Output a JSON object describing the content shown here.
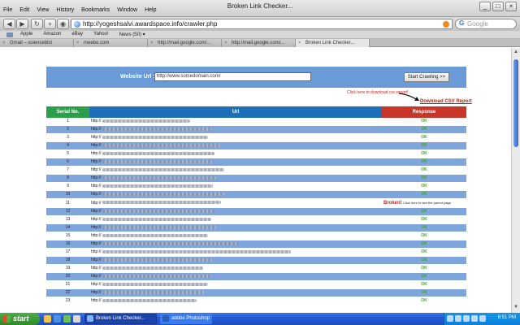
{
  "window": {
    "title": "Broken Link Checker..."
  },
  "menu": [
    "File",
    "Edit",
    "View",
    "History",
    "Bookmarks",
    "Window",
    "Help"
  ],
  "address": {
    "url": "http://yogeshsalvi.awardspace.info/crawler.php"
  },
  "search": {
    "placeholder": "Google",
    "engine_glyph": "G"
  },
  "bookmarks": [
    "Apple",
    "Amazon",
    "eBay",
    "Yahoo!",
    "News (50) ▾"
  ],
  "tabs": [
    {
      "label": "Gmail – scienceblst"
    },
    {
      "label": "meebo.com"
    },
    {
      "label": "http://mail.google.com/..."
    },
    {
      "label": "http://mail.google.com/..."
    },
    {
      "label": "Broken Link Checker..."
    }
  ],
  "form": {
    "label": "Website Url :",
    "value": "http://www.somedomain.com/",
    "button": "Start Crawling >>"
  },
  "csv": {
    "hint": "Click here to download csv report!",
    "link": "Download CSV Report"
  },
  "table": {
    "headers": [
      "Serial No.",
      "Url",
      "Response"
    ],
    "rows": [
      {
        "sn": "1",
        "url": "http://",
        "response": "OK"
      },
      {
        "sn": "2",
        "url": "http://",
        "response": "OK"
      },
      {
        "sn": "3",
        "url": "http://",
        "response": "OK"
      },
      {
        "sn": "4",
        "url": "http://",
        "response": "OK"
      },
      {
        "sn": "5",
        "url": "http://",
        "response": "OK"
      },
      {
        "sn": "6",
        "url": "http://",
        "response": "OK"
      },
      {
        "sn": "7",
        "url": "http://",
        "response": "OK"
      },
      {
        "sn": "8",
        "url": "http://",
        "response": "OK"
      },
      {
        "sn": "9",
        "url": "http://",
        "response": "OK"
      },
      {
        "sn": "10",
        "url": "http://",
        "response": "OK"
      },
      {
        "sn": "11",
        "url": "http://",
        "response": "Broken!",
        "note": "Click here to see the parent page"
      },
      {
        "sn": "12",
        "url": "http://",
        "response": "OK"
      },
      {
        "sn": "13",
        "url": "http://",
        "response": "OK"
      },
      {
        "sn": "14",
        "url": "http://",
        "response": "OK"
      },
      {
        "sn": "15",
        "url": "http://",
        "response": "OK"
      },
      {
        "sn": "16",
        "url": "http://",
        "response": "OK"
      },
      {
        "sn": "17",
        "url": "http://",
        "response": "OK"
      },
      {
        "sn": "18",
        "url": "http://",
        "response": "OK"
      },
      {
        "sn": "19",
        "url": "http://",
        "response": "OK"
      },
      {
        "sn": "20",
        "url": "http://",
        "response": "OK"
      },
      {
        "sn": "21",
        "url": "http://",
        "response": "OK"
      },
      {
        "sn": "22",
        "url": "http://",
        "response": "OK"
      },
      {
        "sn": "23",
        "url": "http://",
        "response": "OK"
      }
    ]
  },
  "taskbar": {
    "start": "start",
    "tasks": [
      "Broken Link Checker...",
      "adobe Photoshop"
    ],
    "clock": "8:51 PM"
  },
  "colors": {
    "serial_header": "#28a04a",
    "url_header": "#1f6fb8",
    "response_header": "#c9352a",
    "form_panel": "#6a9bd8",
    "ok": "#3fa52c",
    "broken": "#c0261f"
  }
}
